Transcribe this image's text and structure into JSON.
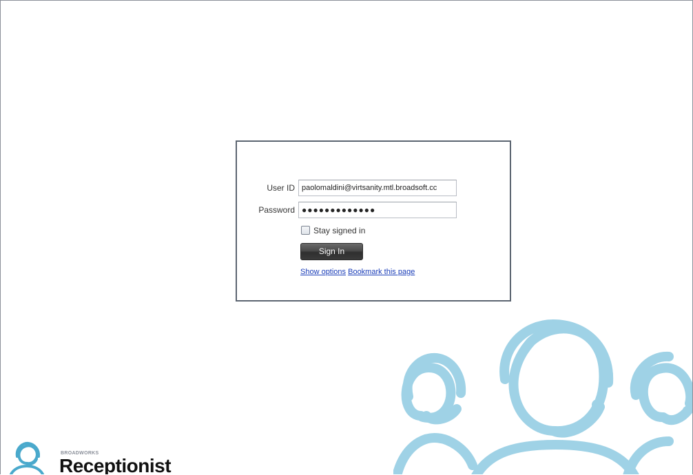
{
  "login": {
    "user_id_label": "User ID",
    "user_id_value": "paolomaldini@virtsanity.mtl.broadsoft.cc",
    "password_label": "Password",
    "password_masked": "●●●●●●●●●●●●●",
    "stay_signed_in_label": "Stay signed in",
    "stay_signed_in_checked": false,
    "sign_in_label": "Sign In",
    "show_options_link": "Show options",
    "bookmark_link": "Bookmark this page"
  },
  "branding": {
    "product_small": "BROADWORKS",
    "product_name": "Receptionist",
    "icon": "receptionist-headset-icon"
  },
  "colors": {
    "accent": "#7fc4dc",
    "link": "#1a3db8",
    "button": "#3a3a3a"
  }
}
